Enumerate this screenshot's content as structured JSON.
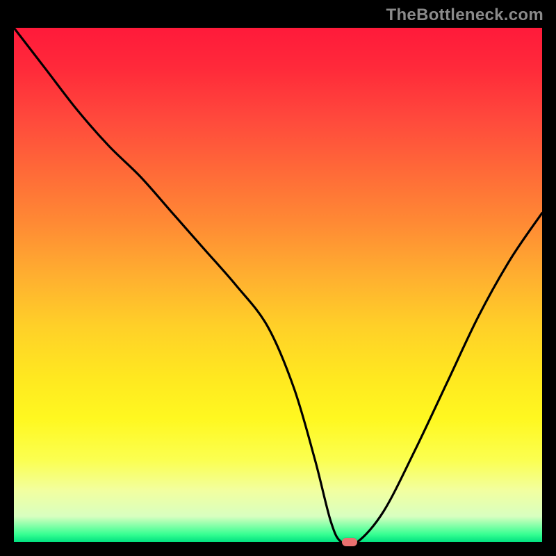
{
  "watermark": "TheBottleneck.com",
  "chart_data": {
    "type": "line",
    "title": "",
    "xlabel": "",
    "ylabel": "",
    "xlim": [
      0,
      100
    ],
    "ylim": [
      0,
      100
    ],
    "grid": false,
    "legend": false,
    "series": [
      {
        "name": "bottleneck-curve",
        "x": [
          0,
          6,
          12,
          18,
          24,
          30,
          36,
          42,
          48,
          53,
          57,
          60,
          62,
          65,
          70,
          76,
          82,
          88,
          94,
          100
        ],
        "values": [
          100,
          92,
          84,
          77,
          71,
          64,
          57,
          50,
          42,
          30,
          16,
          4,
          0,
          0,
          6,
          18,
          31,
          44,
          55,
          64
        ]
      }
    ],
    "marker": {
      "x": 63.5,
      "y": 0,
      "color": "#e97070"
    },
    "gradient_stops": [
      {
        "pos": 0.0,
        "color": "#ff1a3a"
      },
      {
        "pos": 0.18,
        "color": "#ff4a3c"
      },
      {
        "pos": 0.38,
        "color": "#ff8a34"
      },
      {
        "pos": 0.58,
        "color": "#ffd028"
      },
      {
        "pos": 0.76,
        "color": "#fff820"
      },
      {
        "pos": 0.9,
        "color": "#f2ffa0"
      },
      {
        "pos": 0.985,
        "color": "#36ff92"
      },
      {
        "pos": 1.0,
        "color": "#00e080"
      }
    ]
  }
}
